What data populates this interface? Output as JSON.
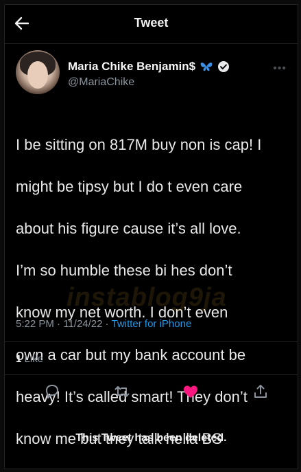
{
  "header": {
    "title": "Tweet",
    "back_icon": "arrow-left-icon"
  },
  "author": {
    "display_name": "Maria Chike Benjamin$",
    "username": "@MariaChike",
    "emoji_icon": "butterfly-icon",
    "verified_icon": "verified-badge-icon"
  },
  "tweet": {
    "lines": [
      "I be sitting on 817M buy non is cap! I",
      "might be tipsy but I do t even care",
      "about his figure cause it’s all love.",
      "I’m so humble these bi hes don’t",
      "know my net worth. I don’t even",
      "own a car but my bank account be",
      "heavy! It’s called smart! They don’t",
      "know me but they talk hella BS"
    ]
  },
  "meta": {
    "time": "5:22 PM",
    "dot1": "·",
    "date": "11/24/22",
    "dot2": "·",
    "source": "Twitter for iPhone"
  },
  "stats": {
    "likes_count": "1",
    "likes_label": "Like"
  },
  "actions": {
    "reply_icon": "reply-icon",
    "retweet_icon": "retweet-icon",
    "like_icon": "heart-icon",
    "share_icon": "share-icon",
    "like_color": "#f91880"
  },
  "watermark": "instablog9ja",
  "status": {
    "deleted_text": "This Tweet has been deleted."
  }
}
